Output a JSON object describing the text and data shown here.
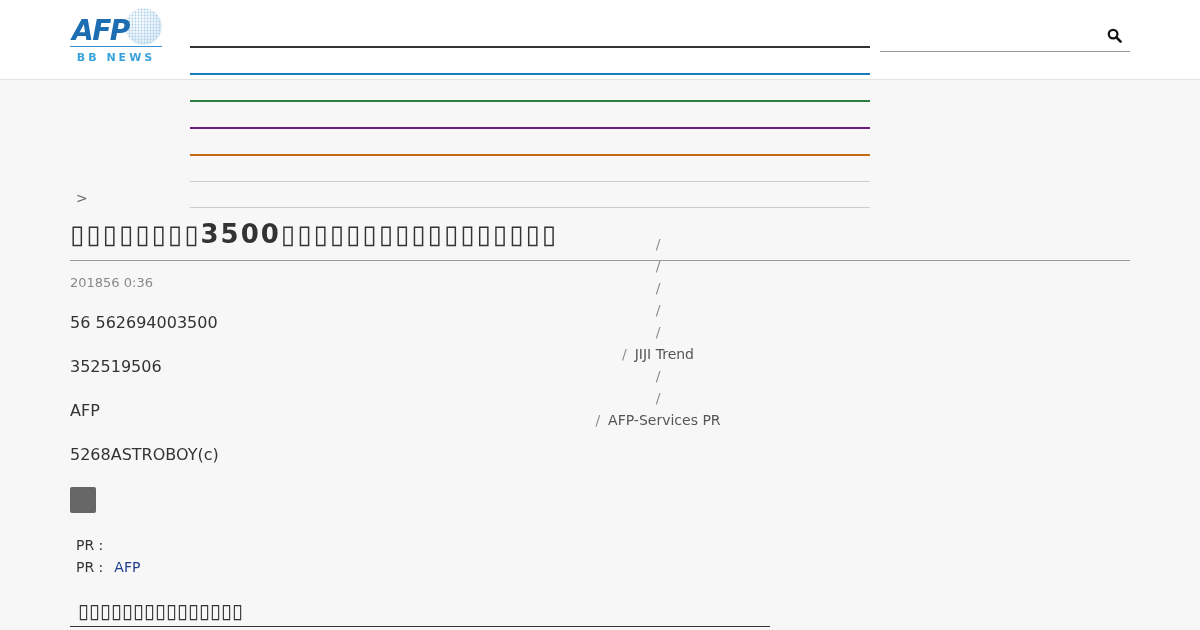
{
  "header": {
    "logo": {
      "wordmark": "AFP",
      "tagline": "BB NEWS"
    },
    "nav": {
      "items": [
        {
          "kind": "category",
          "color": "#333333"
        },
        {
          "kind": "category",
          "color": "#1a7bbf"
        },
        {
          "kind": "category",
          "color": "#2e7d3e"
        },
        {
          "kind": "category",
          "color": "#6d1d7d"
        },
        {
          "kind": "category",
          "color": "#c46a12"
        },
        {
          "kind": "plain",
          "color": "#cccccc"
        },
        {
          "kind": "plain",
          "color": "#cccccc"
        }
      ]
    }
  },
  "breadcrumb": {
    "separator": ">"
  },
  "article": {
    "title": "▯▯▯▯▯▯▯▯3500▯▯▯▯▯▯▯▯▯▯▯▯▯▯▯▯▯",
    "date": "201856 0:36",
    "paragraphs": [
      "56 562694003500",
      "352519506",
      "AFP",
      "5268ASTROBOY(c)"
    ],
    "pr_lines": [
      {
        "label": "PR :"
      },
      {
        "label": "PR :",
        "link": "AFP"
      }
    ]
  },
  "side_links": [
    {
      "separator": "/"
    },
    {
      "separator": "/"
    },
    {
      "separator": "/"
    },
    {
      "separator": "/"
    },
    {
      "separator": "/"
    },
    {
      "separator": "/",
      "label": "JIJI Trend"
    },
    {
      "separator": "/"
    },
    {
      "separator": "/"
    },
    {
      "separator": "/",
      "label": "AFP-Services PR"
    }
  ],
  "related": {
    "heading": "▯▯▯▯▯▯▯▯▯▯▯▯▯▯▯"
  }
}
